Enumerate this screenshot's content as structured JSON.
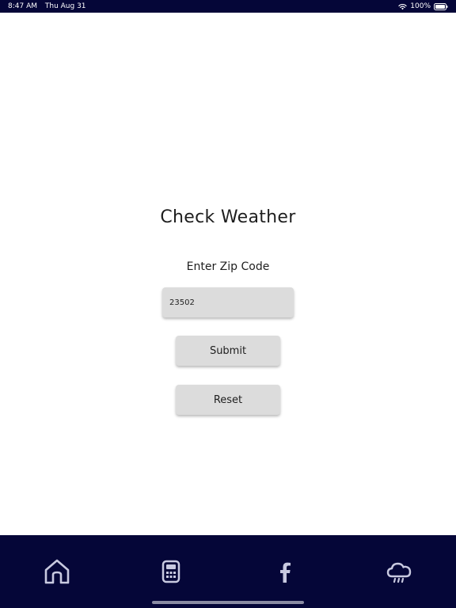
{
  "status_bar": {
    "time": "8:47 AM",
    "date": "Thu Aug 31",
    "battery": "100%",
    "icons": [
      "wifi-icon",
      "battery-icon"
    ]
  },
  "main": {
    "title": "Check Weather",
    "zip_label": "Enter Zip Code",
    "zip_value": "23502",
    "submit_label": "Submit",
    "reset_label": "Reset"
  },
  "tab_bar": {
    "tabs": [
      {
        "icon": "home-icon"
      },
      {
        "icon": "calculator-icon"
      },
      {
        "icon": "facebook-icon"
      },
      {
        "icon": "weather-icon",
        "active": true
      }
    ]
  },
  "colors": {
    "bar_background": "#050638",
    "button_background": "#dcdcdc",
    "icon_color": "#c8c9e0",
    "text": "#1e1e1e"
  }
}
